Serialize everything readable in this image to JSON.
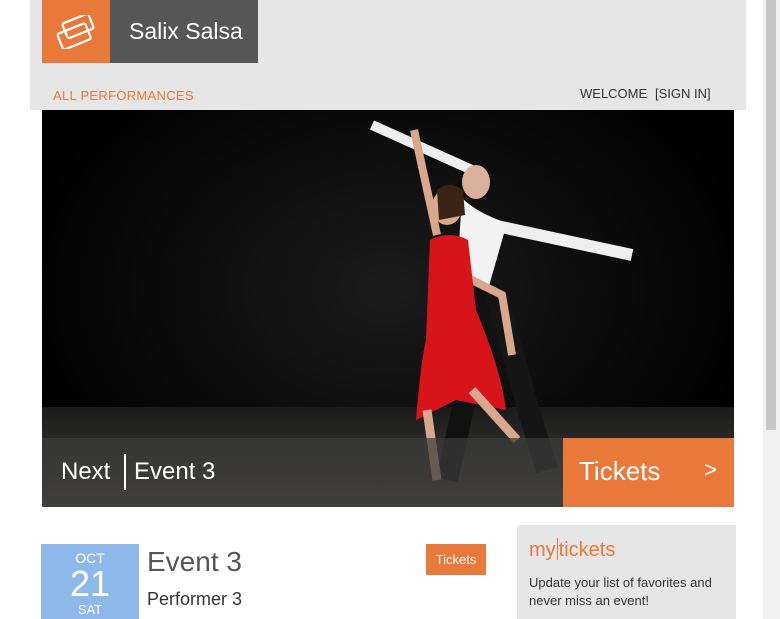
{
  "brand": {
    "name": "Salix Salsa",
    "logo_icon": "ticket-icon",
    "accent": "#e8793a"
  },
  "nav": {
    "all_performances": "ALL PERFORMANCES",
    "welcome": "WELCOME",
    "sign_in": "[SIGN IN]"
  },
  "hero": {
    "next_label": "Next",
    "event_name": "Event 3",
    "tickets_label": "Tickets",
    "tickets_arrow": ">"
  },
  "event": {
    "month": "OCT",
    "day": "21",
    "weekday": "SAT",
    "title": "Event 3",
    "performer": "Performer 3",
    "tickets_label": "Tickets",
    "date_color": "#8db8ea"
  },
  "my_tickets": {
    "title_my": "my",
    "title_tickets": "tickets",
    "text": "Update your list of favorites and never miss an event!"
  }
}
